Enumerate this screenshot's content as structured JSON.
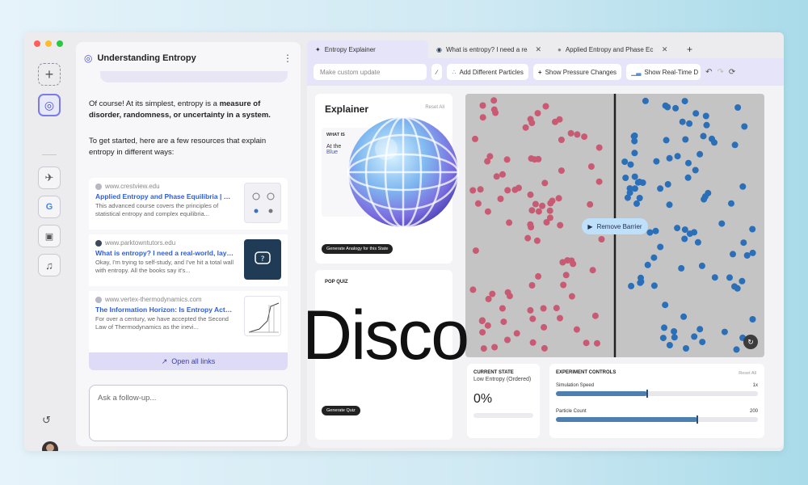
{
  "window": {
    "light_colors": [
      "#ff5f57",
      "#febc2e",
      "#28c840"
    ]
  },
  "rail": {
    "items": [
      "plus-icon",
      "spiral-icon",
      "plane-icon",
      "google-icon",
      "shopping-icon",
      "music-icon"
    ]
  },
  "chat": {
    "title": "Understanding Entropy",
    "intro_prefix": "Of course! At its simplest, entropy is a ",
    "intro_bold": "measure of disorder, randomness, or uncertainty in a system.",
    "resources_intro": "To get started, here are a few resources that explain entropy in different ways:",
    "resources": [
      {
        "domain": "www.crestview.edu",
        "title": "Applied Entropy and Phase Equilibria | Crest...",
        "snippet": "This advanced course covers the principles of statistical entropy and complex equilibria..."
      },
      {
        "domain": "www.parktowntutors.edu",
        "title": "What is entropy? I need a real-world, layman's",
        "snippet": "Okay, I'm trying to self-study, and I've hit a total wall with entropy. All the books say it's..."
      },
      {
        "domain": "www.vertex-thermodynamics.com",
        "title": "The Information Horizon: Is Entropy Actuall...",
        "snippet": "For over a century, we have accepted the Second Law of Thermodynamics as the inevi..."
      }
    ],
    "open_all_label": "Open all links",
    "followup_placeholder": "Ask a follow-up..."
  },
  "tabs": [
    {
      "label": "Entropy Explainer"
    },
    {
      "label": "What is entropy? I need a rea"
    },
    {
      "label": "Applied Entropy and Phase Ec"
    }
  ],
  "toolbar": {
    "custom_placeholder": "Make custom update",
    "buttons": [
      "Add Different Particles",
      "Show Pressure Changes",
      "Show Real-Time D"
    ]
  },
  "explainer": {
    "title": "Explainer",
    "reset": "Reset All",
    "what_label": "WHAT IS",
    "what_line1": "At the",
    "what_line2": "Blue",
    "analogy_button": "Generate Analogy for this State"
  },
  "quiz": {
    "title": "POP QUIZ",
    "button": "Generate Quiz"
  },
  "sim": {
    "remove_barrier_label": "Remove Barrier",
    "left_color": "#c95a73",
    "right_color": "#2a6fb8"
  },
  "state": {
    "label": "CURRENT STATE",
    "sub": "Low Entropy (Ordered)",
    "value": "0%"
  },
  "controls": {
    "title": "EXPERIMENT CONTROLS",
    "reset": "Reset All",
    "sliders": [
      {
        "label": "Simulation Speed",
        "value_text": "1x",
        "fraction": 0.45
      },
      {
        "label": "Particle Count",
        "value_text": "200",
        "fraction": 0.7
      }
    ]
  },
  "overlay": {
    "wordmark": "Disco"
  }
}
